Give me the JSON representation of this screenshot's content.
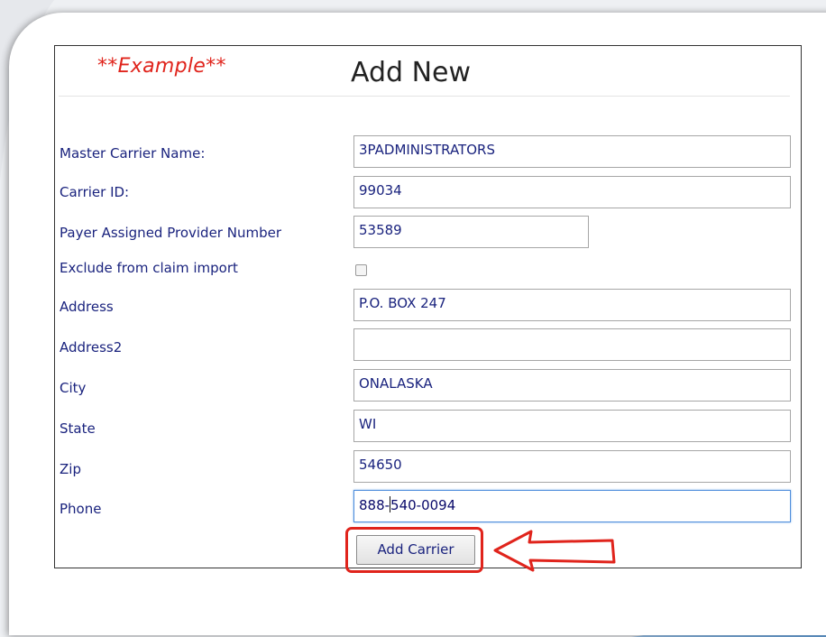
{
  "example_label": "**Example**",
  "page_title": "Add New",
  "fields": [
    {
      "label": "Master Carrier Name:",
      "value": "3PADMINISTRATORS"
    },
    {
      "label": "Carrier ID:",
      "value": "99034"
    },
    {
      "label": "Payer Assigned Provider Number",
      "value": "53589"
    },
    {
      "label": "Exclude from claim import",
      "checked": false
    },
    {
      "label": "Address",
      "value": "P.O. BOX 247"
    },
    {
      "label": "Address2",
      "value": ""
    },
    {
      "label": "City",
      "value": "ONALASKA"
    },
    {
      "label": "State",
      "value": "WI"
    },
    {
      "label": "Zip",
      "value": "54650"
    },
    {
      "label": "Phone",
      "value_before_caret": "888-",
      "value_after_caret": "540-0094"
    }
  ],
  "add_button_label": "Add Carrier",
  "colors": {
    "label": "#1a237e",
    "example_text": "#e0241c",
    "annotation": "#e0241c",
    "focus_border": "#4f8edc",
    "background_accent": "#7fb3e6"
  },
  "annotations": {
    "arrow_icon": "left-arrow-icon",
    "highlight": "red-outline"
  }
}
